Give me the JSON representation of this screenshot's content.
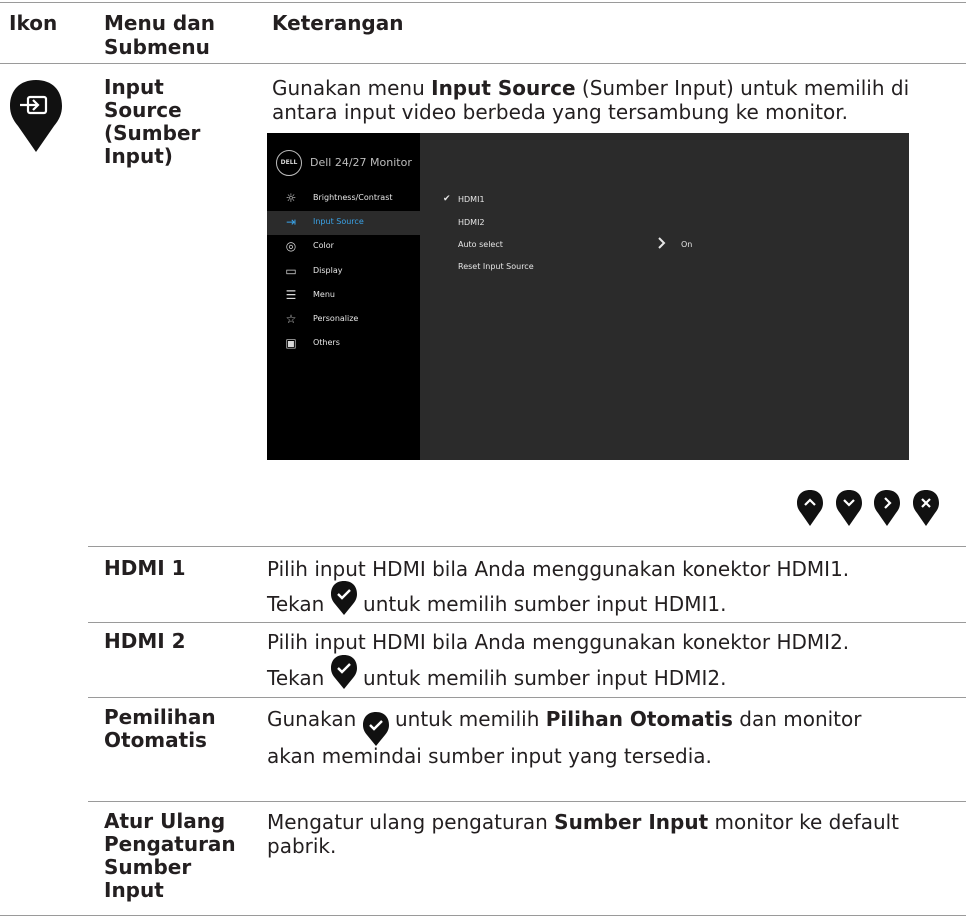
{
  "header": {
    "col_icon": "Ikon",
    "col_menu": "Menu dan Submenu",
    "col_desc": "Keterangan"
  },
  "main": {
    "title": "Input Source (Sumber Input)",
    "desc_pre": "Gunakan menu ",
    "desc_bold": "Input Source",
    "desc_post": " (Sumber Input) untuk memilih di antara input video berbeda yang tersambung ke monitor."
  },
  "osd": {
    "logo": "DELL",
    "title": "Dell 24/27 Monitor",
    "menu": [
      {
        "label": "Brightness/Contrast",
        "icon": "sun-icon"
      },
      {
        "label": "Input Source",
        "icon": "input-icon"
      },
      {
        "label": "Color",
        "icon": "palette-icon"
      },
      {
        "label": "Display",
        "icon": "monitor-icon"
      },
      {
        "label": "Menu",
        "icon": "list-icon"
      },
      {
        "label": "Personalize",
        "icon": "star-icon"
      },
      {
        "label": "Others",
        "icon": "others-icon"
      }
    ],
    "options": [
      "HDMI1",
      "HDMI2",
      "Auto select",
      "Reset Input Source"
    ],
    "auto_value": "On"
  },
  "nav_buttons": [
    "up-button-icon",
    "down-button-icon",
    "right-button-icon",
    "close-button-icon"
  ],
  "rows": [
    {
      "name": "HDMI 1",
      "line1": "Pilih input HDMI bila Anda menggunakan konektor HDMI1.",
      "line2_pre": "Tekan ",
      "line2_post": " untuk memilih sumber input HDMI1."
    },
    {
      "name": "HDMI 2",
      "line1": "Pilih input HDMI bila Anda menggunakan konektor HDMI2.",
      "line2_pre": "Tekan ",
      "line2_post": " untuk memilih sumber input HDMI2."
    },
    {
      "name": "Pemilihan Otomatis",
      "pre": "Gunakan ",
      "mid": " untuk memilih ",
      "bold": "Pilihan Otomatis",
      "post": " dan monitor",
      "line2": "akan memindai sumber input yang tersedia."
    },
    {
      "name": "Atur Ulang Pengaturan Sumber Input",
      "pre": "Mengatur ulang pengaturan ",
      "bold": "Sumber Input",
      "post": " monitor ke default pabrik."
    }
  ]
}
